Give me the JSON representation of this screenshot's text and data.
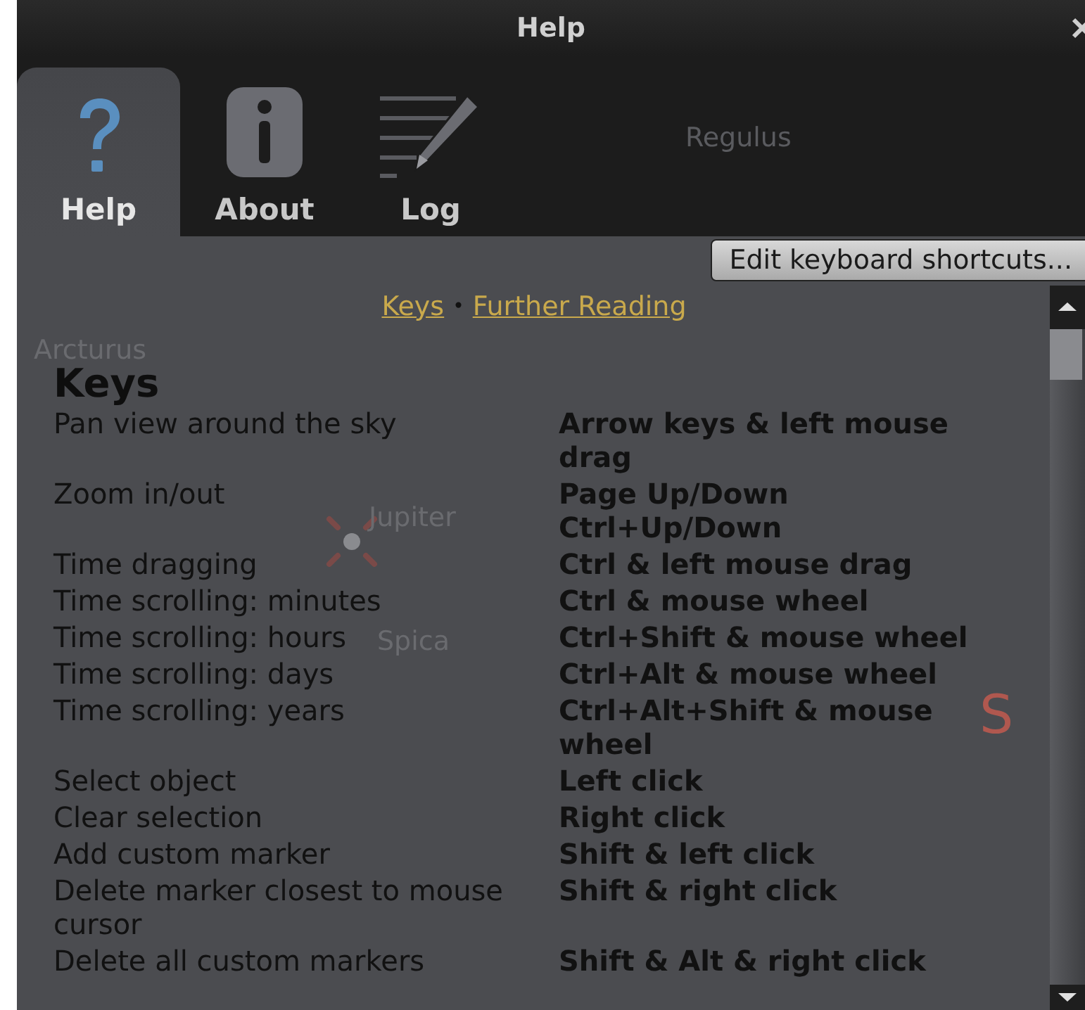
{
  "window": {
    "title": "Help"
  },
  "tabs": [
    {
      "label": "Help",
      "selected": true
    },
    {
      "label": "About",
      "selected": false
    },
    {
      "label": "Log",
      "selected": false
    }
  ],
  "edit_button": "Edit keyboard shortcuts...",
  "links": [
    "Keys",
    "Further Reading"
  ],
  "link_separator": "•",
  "heading": "Keys",
  "rows": [
    {
      "action": "Pan view around the sky",
      "keys": [
        "Arrow keys & left mouse drag"
      ]
    },
    {
      "action": "Zoom in/out",
      "keys": [
        "Page Up/Down",
        "Ctrl+Up/Down"
      ]
    },
    {
      "action": "Time dragging",
      "keys": [
        "Ctrl & left mouse drag"
      ]
    },
    {
      "action": "Time scrolling: minutes",
      "keys": [
        "Ctrl & mouse wheel"
      ]
    },
    {
      "action": "Time scrolling: hours",
      "keys": [
        "Ctrl+Shift & mouse wheel"
      ]
    },
    {
      "action": "Time scrolling: days",
      "keys": [
        "Ctrl+Alt & mouse wheel"
      ]
    },
    {
      "action": "Time scrolling: years",
      "keys": [
        "Ctrl+Alt+Shift & mouse wheel"
      ]
    },
    {
      "action": "Select object",
      "keys": [
        "Left click"
      ]
    },
    {
      "action": "Clear selection",
      "keys": [
        "Right click"
      ]
    },
    {
      "action": "Add custom marker",
      "keys": [
        "Shift & left click"
      ]
    },
    {
      "action": "Delete marker closest to mouse cursor",
      "keys": [
        "Shift & right click"
      ]
    },
    {
      "action": "Delete all custom markers",
      "keys": [
        "Shift & Alt & right click"
      ]
    }
  ],
  "sky_labels": [
    {
      "text": "Regulus",
      "color": "#5a5b5f"
    },
    {
      "text": "Arcturus",
      "color": "#6a6b6f"
    },
    {
      "text": "Jupiter",
      "color": "#6a6b6f"
    },
    {
      "text": "Spica",
      "color": "#6a6b6f"
    },
    {
      "text": "S",
      "color": "#b0584f"
    }
  ]
}
